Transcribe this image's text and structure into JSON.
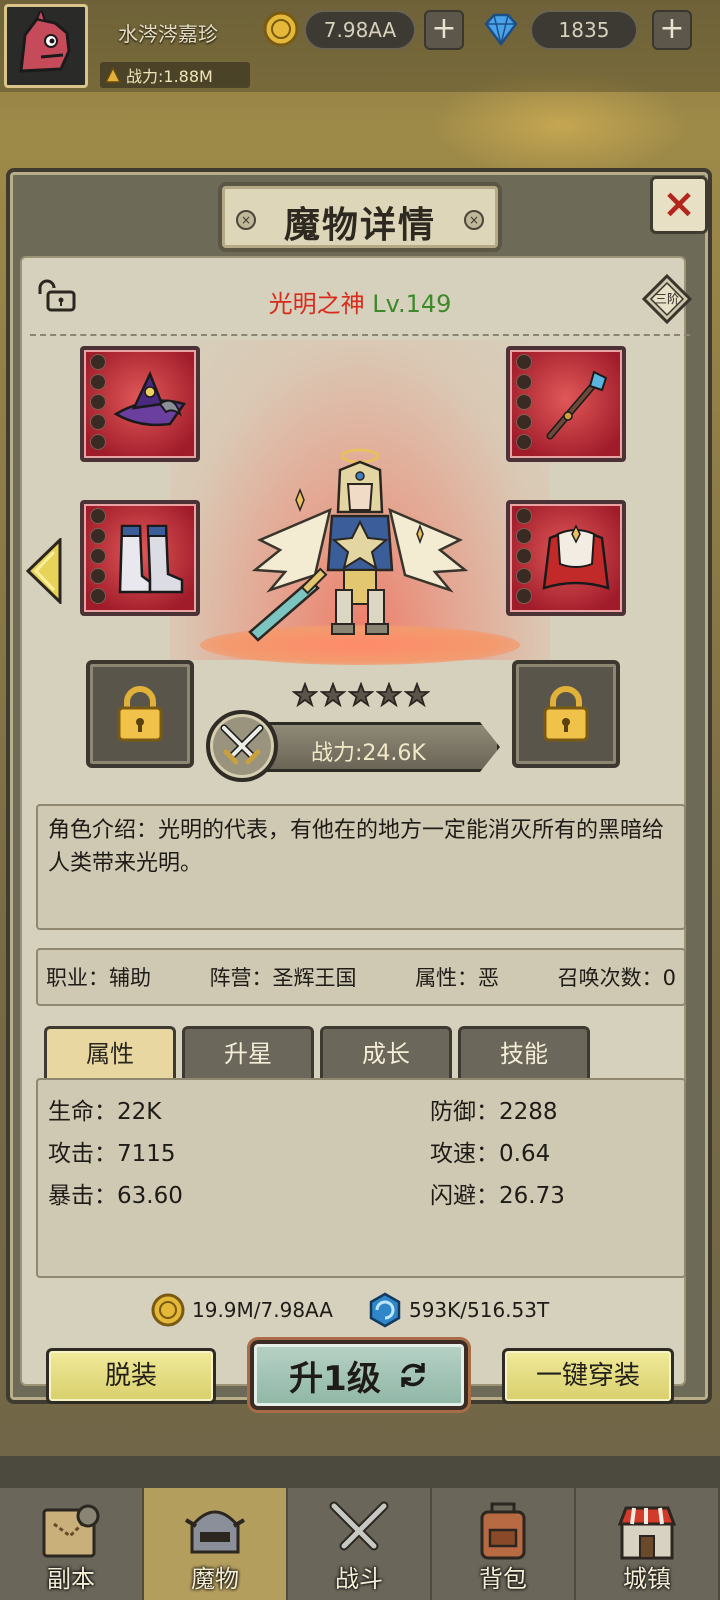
{
  "topbar": {
    "player_name": "水涔涔嘉珍",
    "power_label": "战力:1.88M",
    "gold": "7.98AA",
    "diamonds": "1835",
    "plus": "+"
  },
  "panel": {
    "title": "魔物详情",
    "close": "×",
    "hero_name": "光明之神",
    "hero_level": "Lv.149",
    "tier": "三阶",
    "stars": 5,
    "combat_power": "战力:24.6K",
    "description": "角色介绍：光明的代表，有他在的地方一定能消灭所有的黑暗给人类带来光明。",
    "info": {
      "job": "职业：辅助",
      "faction": "阵营：圣辉王国",
      "attribute": "属性：恶",
      "summons": "召唤次数：0"
    },
    "tabs": [
      "属性",
      "升星",
      "成长",
      "技能"
    ],
    "stats": {
      "hp": "生命：22K",
      "defense": "防御：2288",
      "attack": "攻击：7115",
      "atk_speed": "攻速：0.64",
      "crit": "暴击：63.60",
      "dodge": "闪避：26.73"
    },
    "cost_gold": "19.9M/7.98AA",
    "cost_exp": "593K/516.53T",
    "buttons": {
      "unequip": "脱装",
      "level_up": "升1级",
      "equip_all": "一键穿装"
    }
  },
  "nav": [
    "副本",
    "魔物",
    "战斗",
    "背包",
    "城镇"
  ],
  "colors": {
    "hero_name": "#d92a1c",
    "hero_level": "#3d8a2a",
    "active_tab": "#e8d7a0",
    "close_x": "#b3261e"
  }
}
